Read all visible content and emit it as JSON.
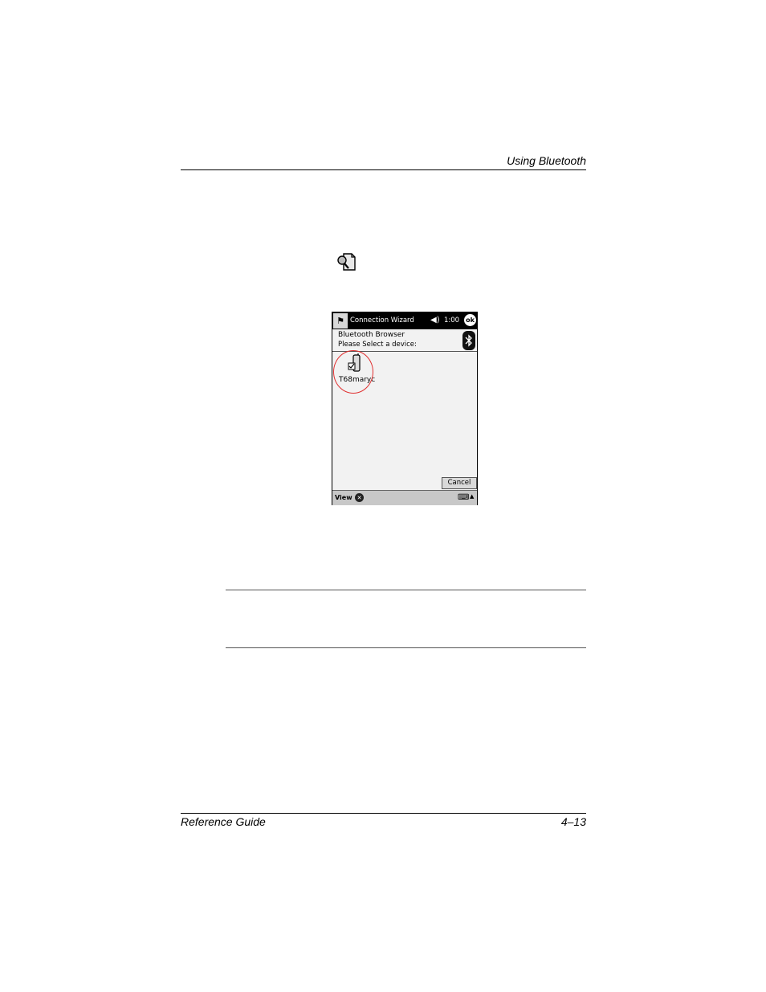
{
  "page": {
    "running_head": "Using Bluetooth",
    "footer_left": "Reference Guide",
    "footer_right": "4–13"
  },
  "inline_icon": {
    "name": "bluetooth-browser-icon"
  },
  "screen": {
    "title": "Connection Wizard",
    "clock": "1:00",
    "ok_label": "ok",
    "header_title": "Bluetooth Browser",
    "header_subtitle": "Please Select a device:",
    "device_name": "T68maryc",
    "cancel_label": "Cancel",
    "view_label": "View"
  },
  "colors": {
    "highlight": "#e03030"
  }
}
